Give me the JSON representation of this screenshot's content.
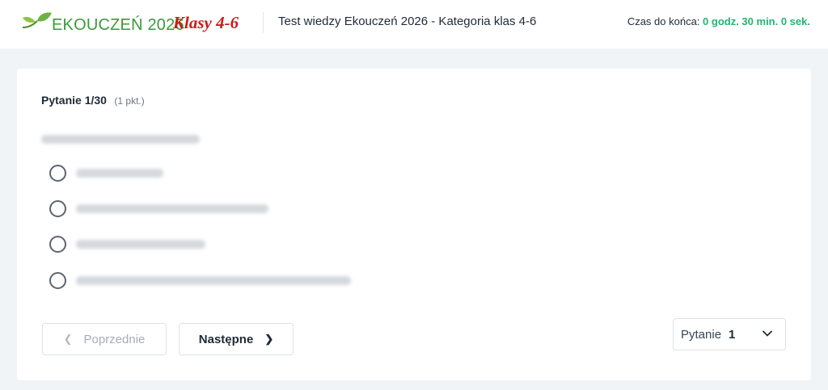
{
  "header": {
    "logo_text": "EKOUCZEŃ 2026",
    "logo_suffix": "Klasy 4-6",
    "test_title": "Test wiedzy Ekouczeń 2026 - Kategoria klas 4-6",
    "timer_label": "Czas do końca:",
    "timer_value": "0 godz. 30 min. 0 sek.",
    "colors": {
      "brand_green": "#3a9a3a",
      "klasy_red": "#d01818",
      "timer_green": "#22b573"
    }
  },
  "question": {
    "number_label": "Pytanie 1/30",
    "points_label": "(1 pkt.)",
    "options_count": 4
  },
  "navigation": {
    "prev_label": "Poprzednie",
    "next_label": "Następne",
    "prev_icon": "chevron-left-icon",
    "next_icon": "chevron-right-icon"
  },
  "question_select": {
    "label": "Pytanie",
    "value": "1",
    "icon": "chevron-down-icon"
  }
}
